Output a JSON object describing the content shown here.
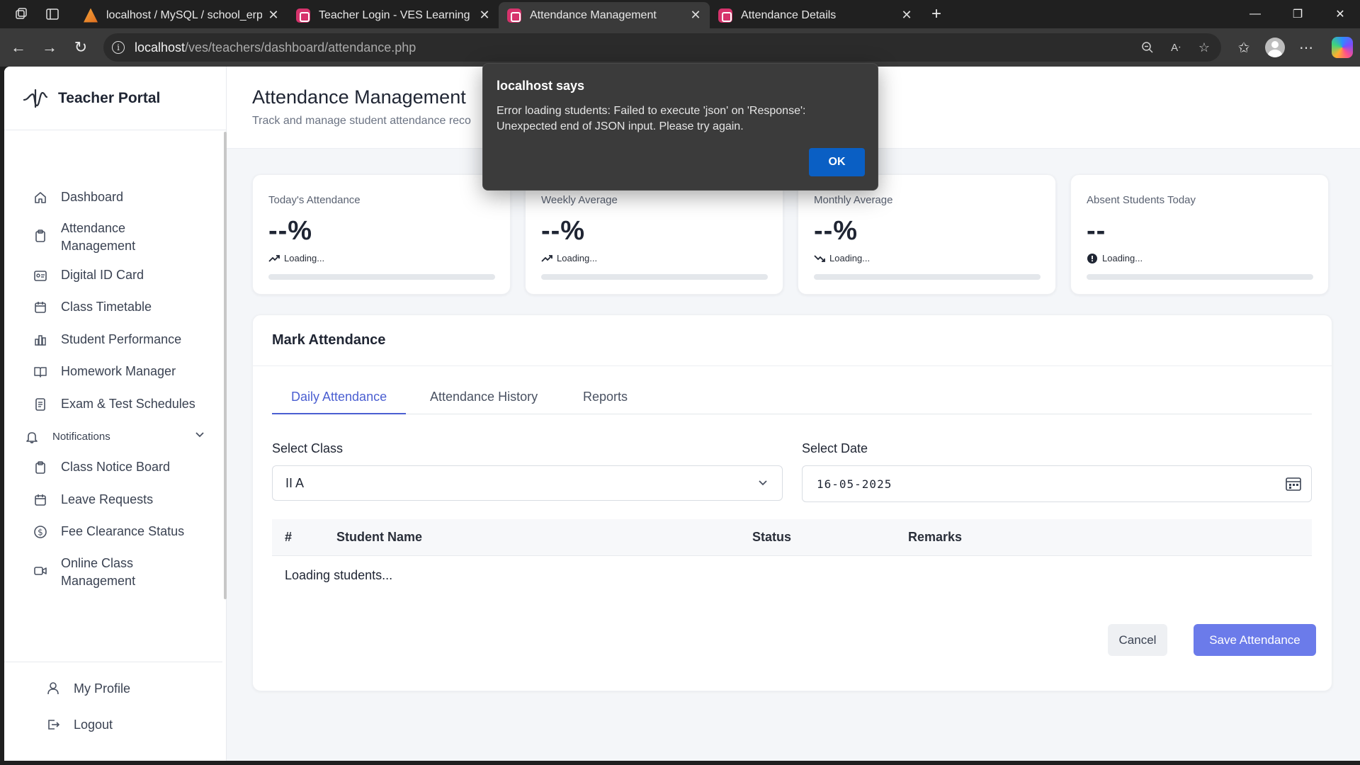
{
  "browser": {
    "tabs": [
      {
        "title": "localhost / MySQL / school_erp / t",
        "active": false
      },
      {
        "title": "Teacher Login - VES Learning Port",
        "active": false
      },
      {
        "title": "Attendance Management",
        "active": true
      },
      {
        "title": "Attendance Details",
        "active": false
      }
    ],
    "url_host": "localhost",
    "url_path": "/ves/teachers/dashboard/attendance.php"
  },
  "sidebar": {
    "brand": "Teacher Portal",
    "items": [
      {
        "label": "Dashboard",
        "icon": "home-icon"
      },
      {
        "label": "Attendance\nManagement",
        "icon": "clipboard-icon"
      },
      {
        "label": "Digital ID Card",
        "icon": "id-card-icon"
      },
      {
        "label": "Class Timetable",
        "icon": "calendar-icon"
      },
      {
        "label": "Student Performance",
        "icon": "bar-chart-icon"
      },
      {
        "label": "Homework Manager",
        "icon": "book-icon"
      },
      {
        "label": "Exam & Test Schedules",
        "icon": "document-icon"
      },
      {
        "label": "Notifications",
        "icon": "bell-icon"
      },
      {
        "label": "Class Notice Board",
        "icon": "clipboard-icon"
      },
      {
        "label": "Leave Requests",
        "icon": "calendar-icon"
      },
      {
        "label": "Fee Clearance Status",
        "icon": "dollar-icon"
      },
      {
        "label": "Online Class\nManagement",
        "icon": "video-icon"
      }
    ],
    "bottom": [
      {
        "label": "My Profile",
        "icon": "user-icon"
      },
      {
        "label": "Logout",
        "icon": "logout-icon"
      }
    ]
  },
  "header": {
    "title": "Attendance Management",
    "subtitle": "Track and manage student attendance reco"
  },
  "stats": [
    {
      "title": "Today's Attendance",
      "value": "--%",
      "status": "Loading...",
      "icon": "trend-up-icon"
    },
    {
      "title": "Weekly Average",
      "value": "--%",
      "status": "Loading...",
      "icon": "trend-up-icon"
    },
    {
      "title": "Monthly Average",
      "value": "--%",
      "status": "Loading...",
      "icon": "trend-down-icon"
    },
    {
      "title": "Absent Students Today",
      "value": "--",
      "status": "Loading...",
      "icon": "alert-circle-icon"
    }
  ],
  "panel": {
    "title": "Mark Attendance",
    "tabs": [
      "Daily Attendance",
      "Attendance History",
      "Reports"
    ],
    "class_label": "Select Class",
    "class_value": "II A",
    "date_label": "Select Date",
    "date_value": "16-05-2025",
    "columns": [
      "#",
      "Student Name",
      "Status",
      "Remarks"
    ],
    "loading_text": "Loading students...",
    "cancel_label": "Cancel",
    "save_label": "Save Attendance"
  },
  "dialog": {
    "title": "localhost says",
    "message": "Error loading students: Failed to execute 'json' on 'Response': Unexpected end of JSON input. Please try again.",
    "ok_label": "OK"
  },
  "colors": {
    "accent": "#4b5fd1",
    "save_button": "#6b7bea",
    "dialog_ok": "#0a5fc4"
  }
}
